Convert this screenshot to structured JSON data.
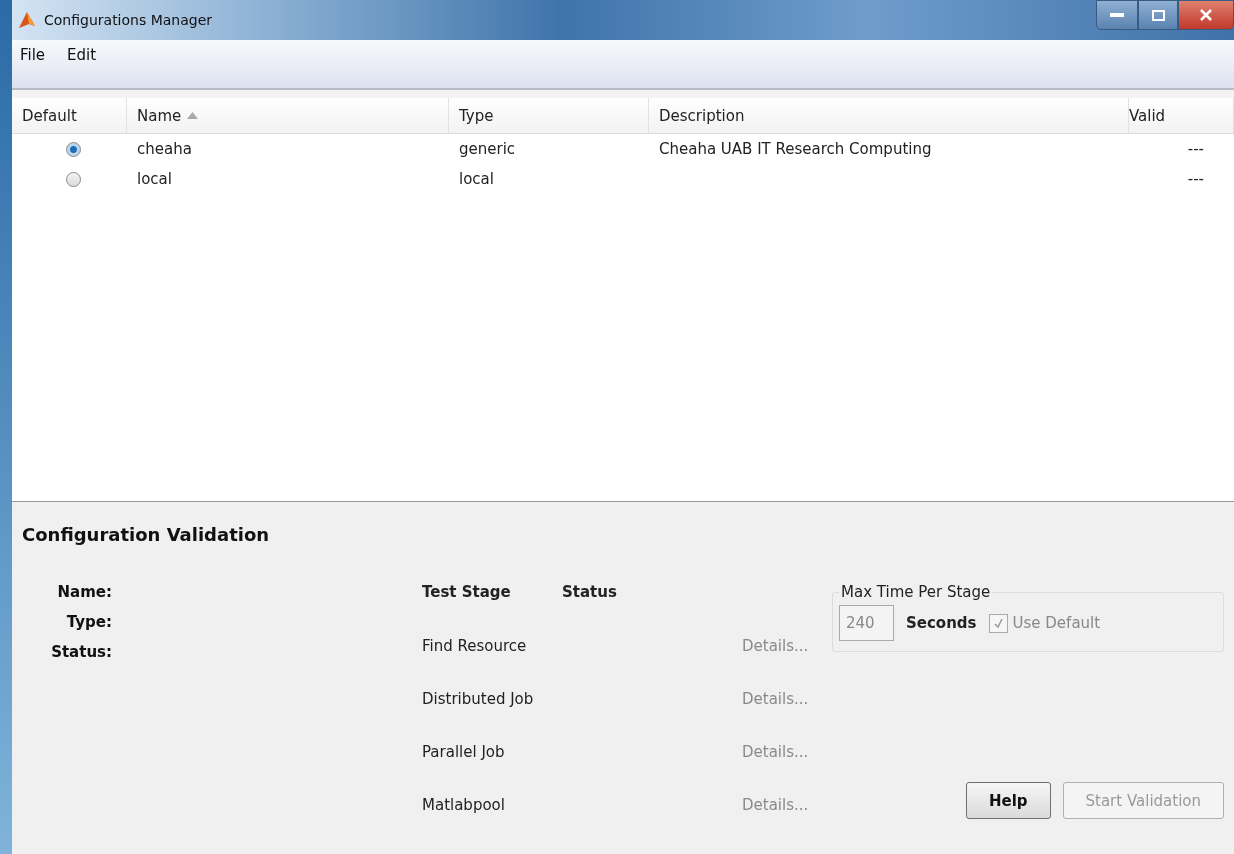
{
  "window": {
    "title": "Configurations Manager"
  },
  "menu": [
    "File",
    "Edit"
  ],
  "table": {
    "columns": [
      {
        "label": "Default",
        "sorted": false
      },
      {
        "label": "Name",
        "sorted": true
      },
      {
        "label": "Type",
        "sorted": false
      },
      {
        "label": "Description",
        "sorted": false
      },
      {
        "label": "Valid",
        "sorted": false
      }
    ],
    "rows": [
      {
        "selected": true,
        "name": "cheaha",
        "type": "generic",
        "description": "Cheaha UAB IT Research Computing",
        "valid": "---"
      },
      {
        "selected": false,
        "name": "local",
        "type": "local",
        "description": "",
        "valid": "---"
      }
    ]
  },
  "validation": {
    "title": "Configuration Validation",
    "labels": [
      "Name:",
      "Type:",
      "Status:"
    ],
    "stage_header": "Test Stage",
    "status_header": "Status",
    "stages": [
      {
        "name": "Find Resource",
        "details": "Details...",
        "disabled": true
      },
      {
        "name": "Distributed Job",
        "details": "Details...",
        "disabled": true
      },
      {
        "name": "Parallel Job",
        "details": "Details...",
        "disabled": true
      },
      {
        "name": "Matlabpool",
        "details": "Details...",
        "disabled": true
      }
    ],
    "max_time": {
      "title": "Max Time Per Stage",
      "value": "240",
      "unit": "Seconds",
      "use_default": {
        "label": "Use Default",
        "checked": true,
        "disabled": true
      }
    },
    "buttons": [
      {
        "label": "Help",
        "disabled": false
      },
      {
        "label": "Start Validation",
        "disabled": true
      }
    ]
  }
}
